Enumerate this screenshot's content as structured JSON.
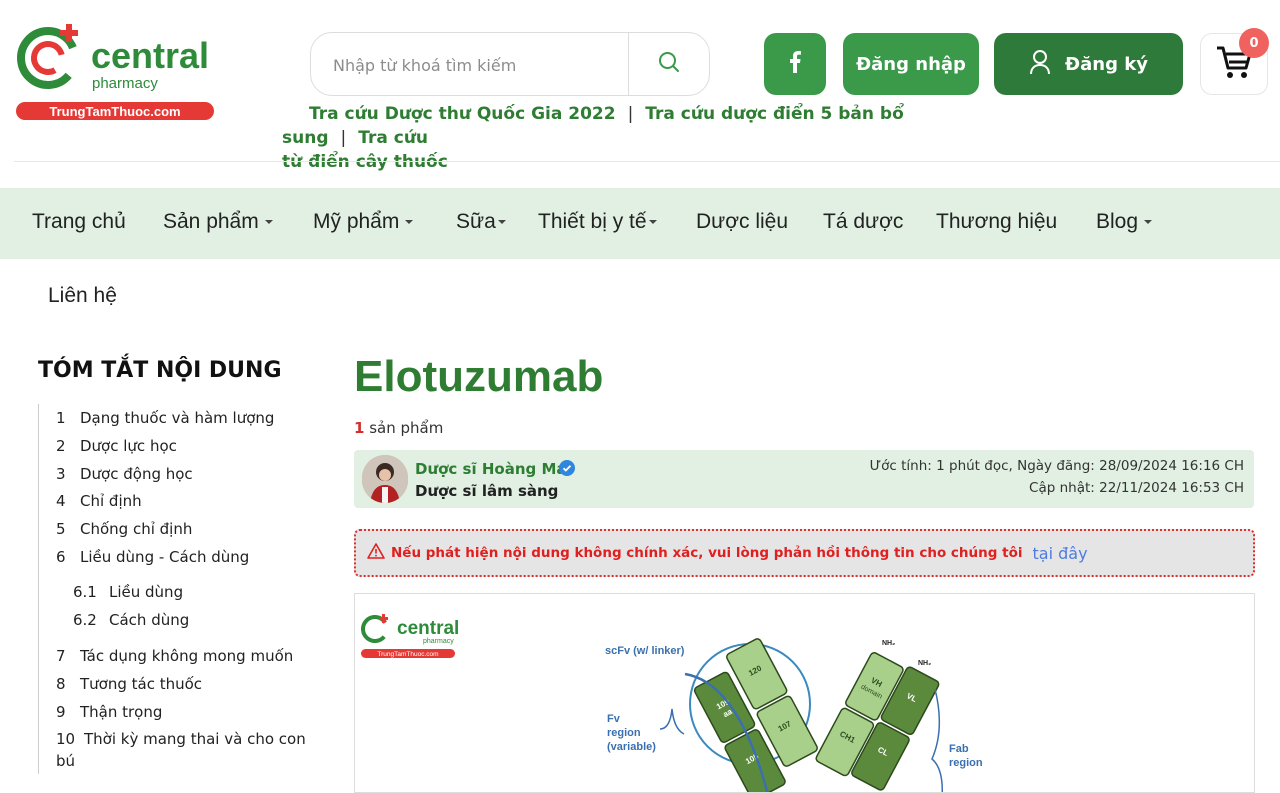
{
  "brand": {
    "logo_text": "central",
    "logo_sub": "pharmacy",
    "logo_tag": "TrungTamThuoc.com",
    "primary_color": "#2e7d32",
    "accent_red": "#e53935"
  },
  "search": {
    "placeholder": "Nhập từ khoá tìm kiếm",
    "icon": "search-icon"
  },
  "header": {
    "facebook_icon": "facebook-icon",
    "login_label": "Đăng nhập",
    "register_label": "Đăng ký",
    "cart_count": "0"
  },
  "quicklinks": [
    "Tra cứu Dược thư Quốc Gia 2022",
    "Tra cứu dược điển 5 bản bổ sung",
    "Tra cứu từ điển cây thuốc"
  ],
  "quicklinks_line2": "từ điển cây thuốc",
  "quicklinks_last_part1": "Tra cứu",
  "nav": {
    "items": [
      {
        "label": "Trang chủ"
      },
      {
        "label": "Sản phẩm"
      },
      {
        "label": "Mỹ phẩm"
      },
      {
        "label": "Sữa"
      },
      {
        "label": "Thiết bị y tế"
      },
      {
        "label": "Dược liệu"
      },
      {
        "label": "Tá dược"
      },
      {
        "label": "Thương hiệu"
      },
      {
        "label": "Blog"
      }
    ],
    "contact": "Liên hệ"
  },
  "toc": {
    "title": "TÓM TẮT NỘI DUNG",
    "items": [
      {
        "num": "1",
        "label": "Dạng thuốc và hàm lượng"
      },
      {
        "num": "2",
        "label": "Dược lực học"
      },
      {
        "num": "3",
        "label": "Dược động học"
      },
      {
        "num": "4",
        "label": "Chỉ định"
      },
      {
        "num": "5",
        "label": "Chống chỉ định"
      },
      {
        "num": "6",
        "label": "Liều dùng - Cách dùng"
      },
      {
        "num": "6.1",
        "label": "Liều dùng"
      },
      {
        "num": "6.2",
        "label": "Cách dùng"
      },
      {
        "num": "7",
        "label": "Tác dụng không mong muốn"
      },
      {
        "num": "8",
        "label": "Tương tác thuốc"
      },
      {
        "num": "9",
        "label": "Thận trọng"
      },
      {
        "num": "10",
        "label": "Thời kỳ mang thai và cho con"
      },
      {
        "num": "",
        "label": "bú"
      }
    ]
  },
  "article": {
    "title": "Elotuzumab",
    "count": "1",
    "count_label": "sản phẩm",
    "author_name": "Dược sĩ Hoàng Mai",
    "author_role": "Dược sĩ lâm sàng",
    "meta_line1": "Ước tính: 1 phút đọc, Ngày đăng: 28/09/2024 16:16 CH",
    "meta_line2": "Cập nhật: 22/11/2024 16:53 CH",
    "warning": "Nếu phát hiện nội dung không chính xác, vui lòng phản hồi thông tin cho chúng tôi",
    "warning_link": "tại đây"
  },
  "figure": {
    "logo_text": "central",
    "logo_sub": "pharmacy",
    "logo_tag": "TrungTamThuoc.com",
    "labels": {
      "scfv": "scFv (w/ linker)",
      "fv": "Fv",
      "fv2": "region",
      "fv3": "(variable)",
      "fab": "Fab",
      "fab2": "region",
      "aa120": "120",
      "aa109": "109",
      "aa107": "107",
      "aa105": "105",
      "aa": "aa",
      "vh": "VH",
      "vl": "VL",
      "ch1": "CH1",
      "cl": "CL",
      "domain": "domain",
      "nh2": "NH₂"
    }
  }
}
